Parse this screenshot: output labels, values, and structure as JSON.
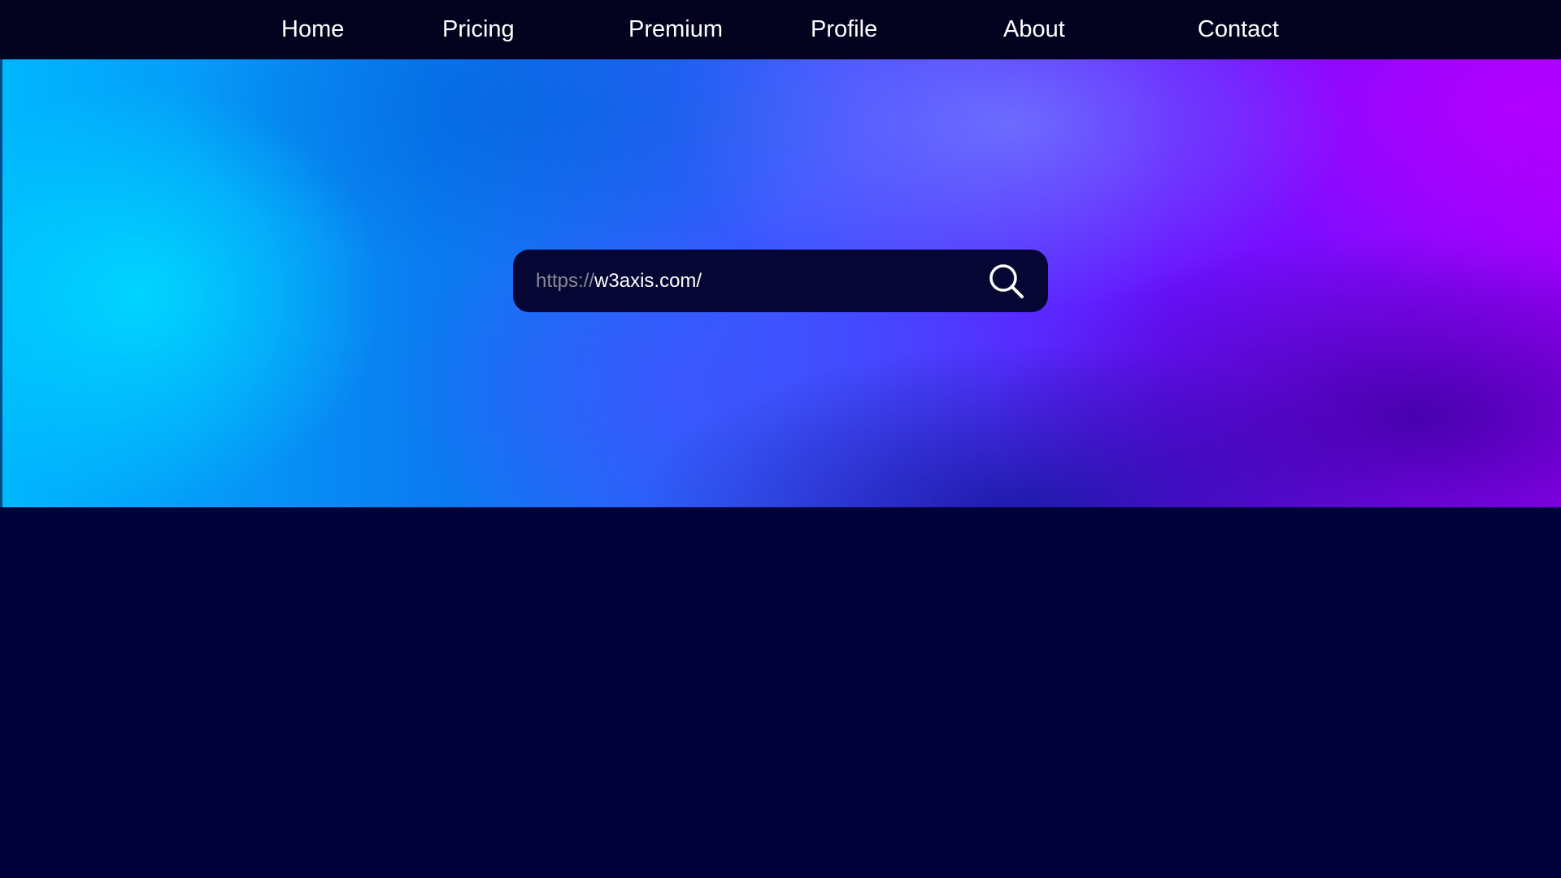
{
  "nav": {
    "items": [
      {
        "label": "Home"
      },
      {
        "label": "Pricing"
      },
      {
        "label": "Premium"
      },
      {
        "label": "Profile"
      },
      {
        "label": "About"
      },
      {
        "label": "Contact"
      }
    ]
  },
  "search": {
    "url_prefix": "https://",
    "url_value": "w3axis.com/",
    "button_icon": "search-icon"
  },
  "colors": {
    "nav_background": "#03031f",
    "page_background": "#00003b",
    "search_background": "#060634",
    "gradient_cyan": "#00b7ff",
    "gradient_blue": "#3a55ff",
    "gradient_purple": "#a000ff"
  }
}
